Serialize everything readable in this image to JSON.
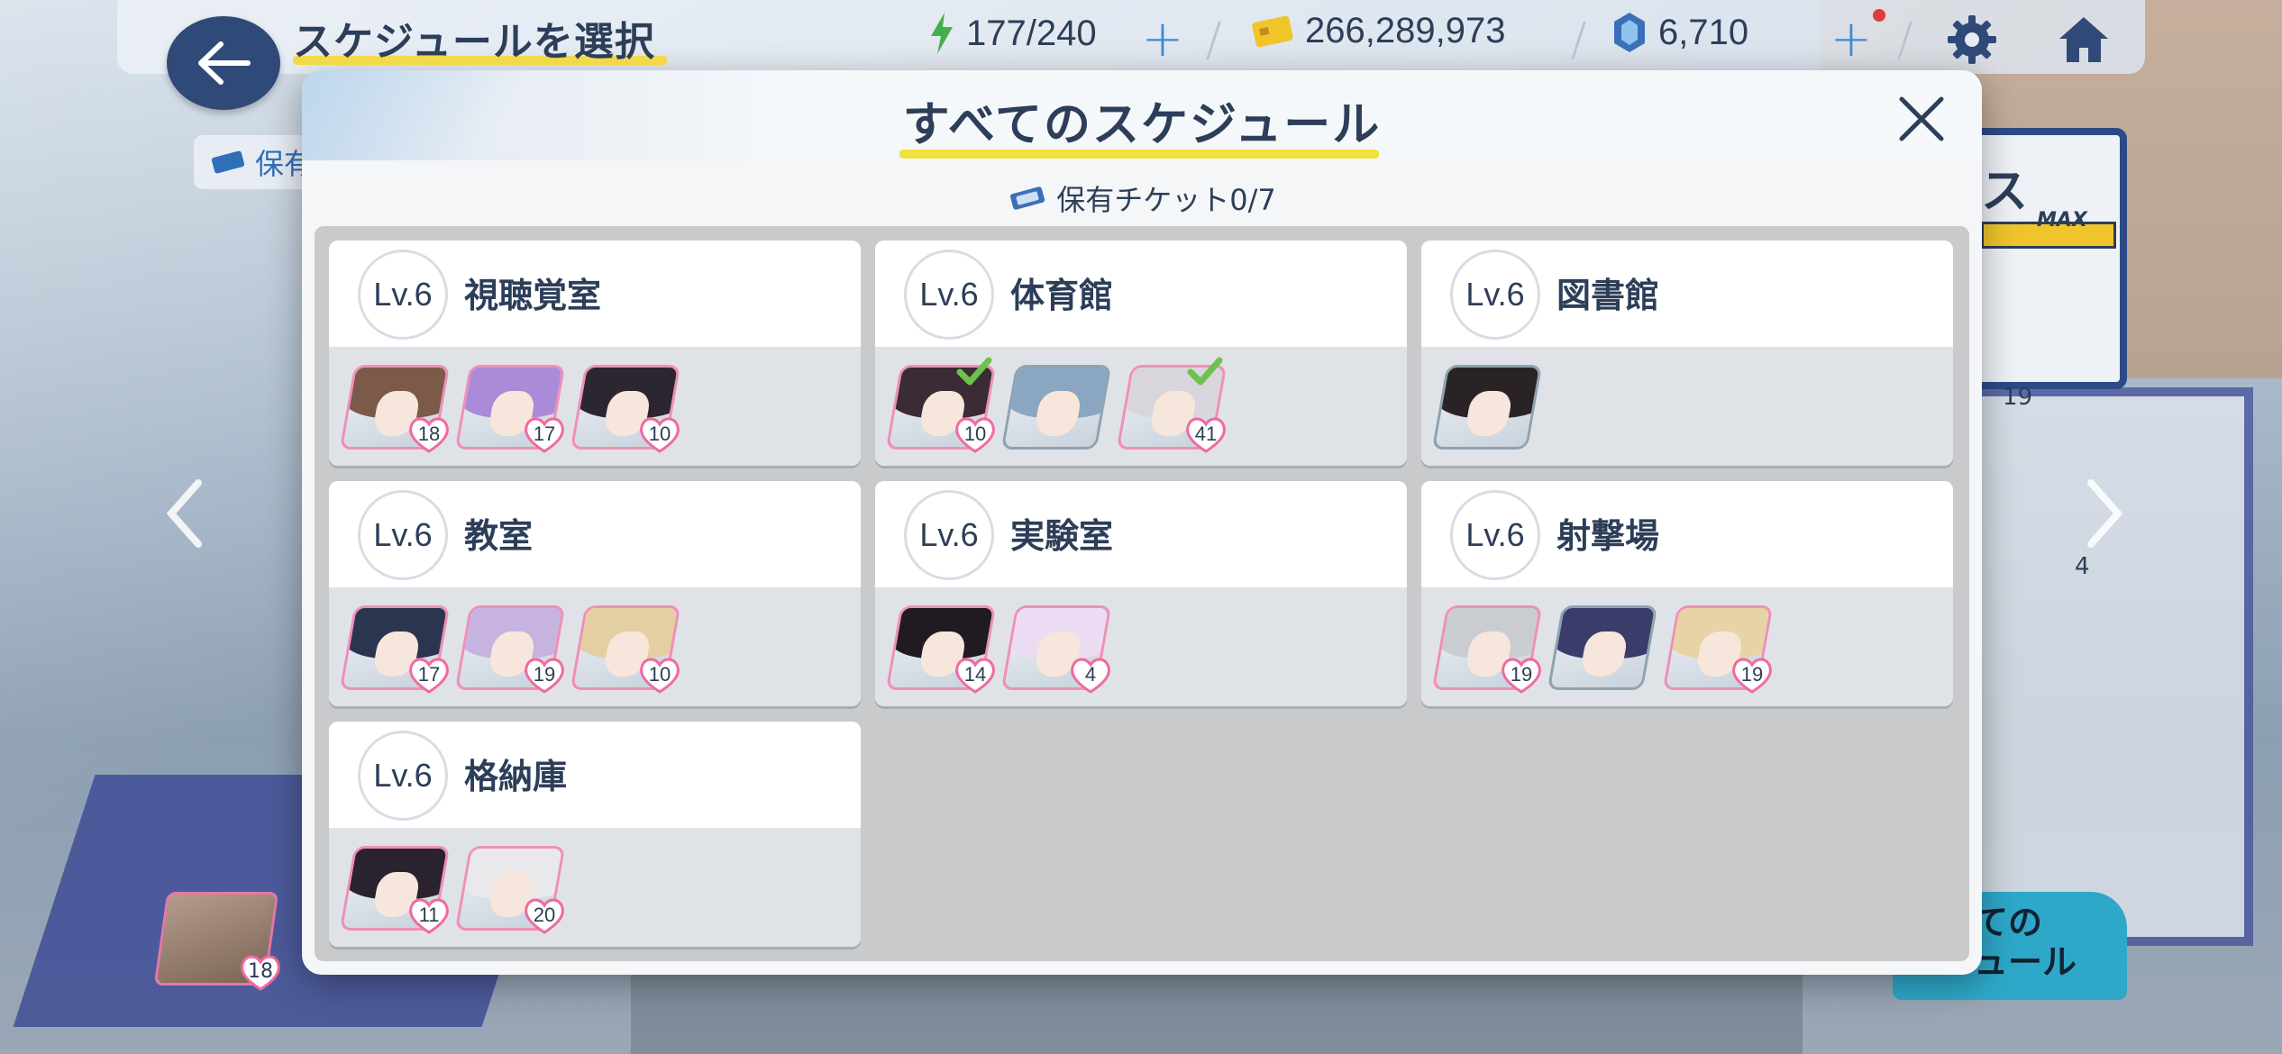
{
  "topbar": {
    "title": "スケジュールを選択",
    "ap_value": "177/240",
    "credit_value": "266,289,973",
    "pyroxene_value": "6,710"
  },
  "background": {
    "ticket_chip_label": "保有",
    "right_panel_label": "ス",
    "right_panel_max": "MAX",
    "right_panel_count_a": "19",
    "right_panel_count_b": "4",
    "bottom_button_line1": "ての",
    "bottom_button_line2": "ュール",
    "bottom_portrait_level": "18"
  },
  "modal": {
    "title": "すべてのスケジュール",
    "ticket_label": "保有チケット0/7",
    "cards": [
      {
        "level": "Lv.6",
        "name": "視聴覚室",
        "students": [
          {
            "level": "18",
            "hair": "#7b5a4a",
            "frame": "pink",
            "checked": false
          },
          {
            "level": "17",
            "hair": "#a98bd8",
            "frame": "pink",
            "checked": false
          },
          {
            "level": "10",
            "hair": "#2c2630",
            "frame": "pink",
            "checked": false
          }
        ]
      },
      {
        "level": "Lv.6",
        "name": "体育館",
        "students": [
          {
            "level": "10",
            "hair": "#3a2b35",
            "frame": "pink",
            "checked": true
          },
          {
            "level": "",
            "hair": "#8aa6c0",
            "frame": "gray",
            "checked": false
          },
          {
            "level": "41",
            "hair": "#d8d6dc",
            "frame": "pink",
            "checked": true
          }
        ]
      },
      {
        "level": "Lv.6",
        "name": "図書館",
        "students": [
          {
            "level": "",
            "hair": "#2a2325",
            "frame": "gray",
            "checked": false
          }
        ]
      },
      {
        "level": "Lv.6",
        "name": "教室",
        "students": [
          {
            "level": "17",
            "hair": "#2b3550",
            "frame": "pink",
            "checked": false
          },
          {
            "level": "19",
            "hair": "#c7b3e0",
            "frame": "pink",
            "checked": false
          },
          {
            "level": "10",
            "hair": "#e4cfa2",
            "frame": "pink",
            "checked": false
          }
        ]
      },
      {
        "level": "Lv.6",
        "name": "実験室",
        "students": [
          {
            "level": "14",
            "hair": "#1f1b21",
            "frame": "pink",
            "checked": false
          },
          {
            "level": "4",
            "hair": "#ecdcf3",
            "frame": "pink",
            "checked": false
          }
        ]
      },
      {
        "level": "Lv.6",
        "name": "射撃場",
        "students": [
          {
            "level": "19",
            "hair": "#c9cdd2",
            "frame": "pink",
            "checked": false
          },
          {
            "level": "",
            "hair": "#3a3c6a",
            "frame": "gray",
            "checked": false
          },
          {
            "level": "19",
            "hair": "#e8d3a6",
            "frame": "pink",
            "checked": false
          }
        ]
      },
      {
        "level": "Lv.6",
        "name": "格納庫",
        "students": [
          {
            "level": "11",
            "hair": "#2b2230",
            "frame": "pink",
            "checked": false
          },
          {
            "level": "20",
            "hair": "#e9e9ec",
            "frame": "pink",
            "checked": false
          }
        ]
      }
    ]
  },
  "colors": {
    "accent_blue": "#3a8ad8",
    "title_underline": "#f3df3f",
    "heart_pink": "#f06aa0",
    "check_green": "#6cc24a",
    "ap_green": "#43b04a",
    "credit_yellow": "#f0c52c",
    "pyroxene_blue": "#3b6fb8"
  },
  "icons": {
    "back": "arrow-left-icon",
    "ap": "lightning-icon",
    "credit": "credit-card-icon",
    "pyroxene": "gem-icon",
    "settings": "gear-icon",
    "home": "home-icon",
    "close": "close-icon",
    "ticket": "ticket-icon",
    "heart": "heart-icon",
    "check": "check-icon",
    "left_arrow": "chevron-left-icon",
    "right_arrow": "chevron-right-icon"
  }
}
